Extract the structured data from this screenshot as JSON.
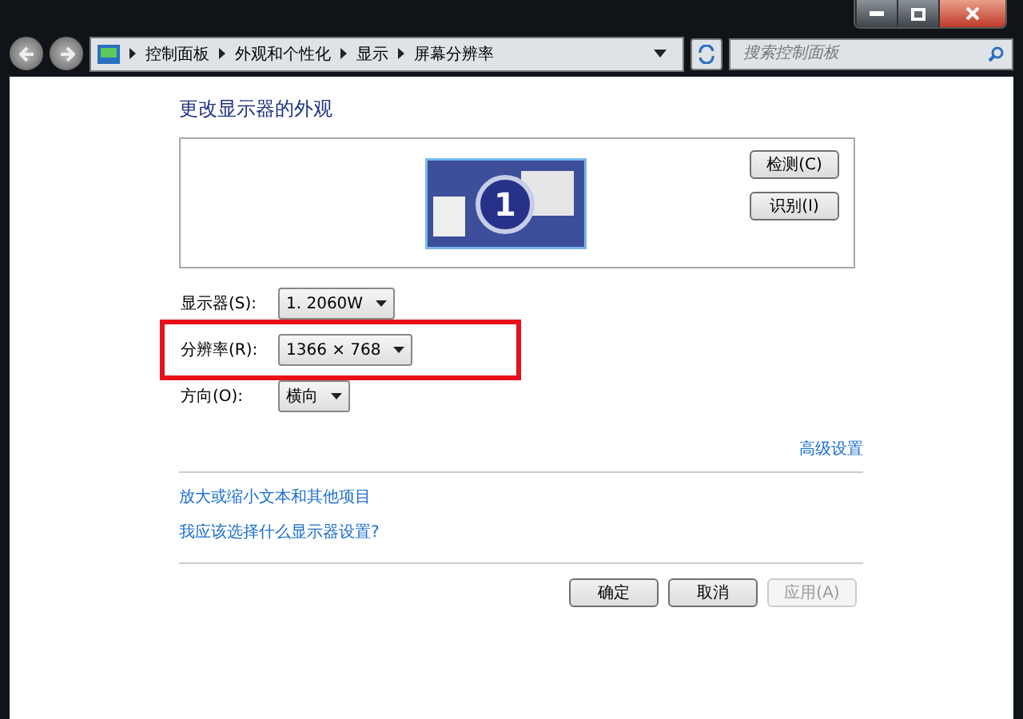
{
  "nav": {
    "breadcrumbs": [
      "控制面板",
      "外观和个性化",
      "显示",
      "屏幕分辨率"
    ],
    "search": {
      "placeholder": "搜索控制面板"
    }
  },
  "heading": "更改显示器的外观",
  "preview": {
    "monitor_number": "1",
    "buttons": [
      "检测(C)",
      "识别(I)"
    ]
  },
  "settings": [
    {
      "label": "显示器(S):",
      "value": "1. 2060W",
      "highlighted": false
    },
    {
      "label": "分辨率(R):",
      "value": "1366 × 768",
      "highlighted": true
    },
    {
      "label": "方向(O):",
      "value": "横向",
      "highlighted": false
    }
  ],
  "advanced_link": "高级设置",
  "links": [
    "放大或缩小文本和其他项目",
    "我应该选择什么显示器设置?"
  ],
  "buttons": [
    {
      "label": "确定",
      "disabled": false
    },
    {
      "label": "取消",
      "disabled": false
    },
    {
      "label": "应用(A)",
      "disabled": true
    }
  ]
}
